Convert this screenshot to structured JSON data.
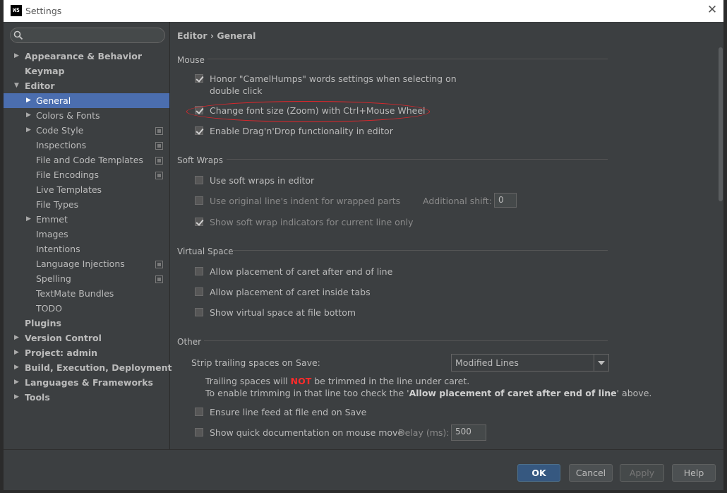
{
  "window": {
    "title": "Settings",
    "app_icon": "WS"
  },
  "search": {
    "placeholder": ""
  },
  "tree": [
    {
      "label": "Appearance & Behavior",
      "level": 0,
      "arrow": "▶"
    },
    {
      "label": "Keymap",
      "level": 0,
      "arrow": ""
    },
    {
      "label": "Editor",
      "level": 0,
      "arrow": "▼"
    },
    {
      "label": "General",
      "level": 1,
      "arrow": "▶",
      "selected": true
    },
    {
      "label": "Colors & Fonts",
      "level": 1,
      "arrow": "▶"
    },
    {
      "label": "Code Style",
      "level": 1,
      "arrow": "▶",
      "project": true
    },
    {
      "label": "Inspections",
      "level": 1,
      "arrow": "",
      "project": true
    },
    {
      "label": "File and Code Templates",
      "level": 1,
      "arrow": "",
      "project": true
    },
    {
      "label": "File Encodings",
      "level": 1,
      "arrow": "",
      "project": true
    },
    {
      "label": "Live Templates",
      "level": 1,
      "arrow": ""
    },
    {
      "label": "File Types",
      "level": 1,
      "arrow": ""
    },
    {
      "label": "Emmet",
      "level": 1,
      "arrow": "▶"
    },
    {
      "label": "Images",
      "level": 1,
      "arrow": ""
    },
    {
      "label": "Intentions",
      "level": 1,
      "arrow": ""
    },
    {
      "label": "Language Injections",
      "level": 1,
      "arrow": "",
      "project": true
    },
    {
      "label": "Spelling",
      "level": 1,
      "arrow": "",
      "project": true
    },
    {
      "label": "TextMate Bundles",
      "level": 1,
      "arrow": ""
    },
    {
      "label": "TODO",
      "level": 1,
      "arrow": ""
    },
    {
      "label": "Plugins",
      "level": 0,
      "arrow": ""
    },
    {
      "label": "Version Control",
      "level": 0,
      "arrow": "▶"
    },
    {
      "label": "Project: admin",
      "level": 0,
      "arrow": "▶"
    },
    {
      "label": "Build, Execution, Deployment",
      "level": 0,
      "arrow": "▶"
    },
    {
      "label": "Languages & Frameworks",
      "level": 0,
      "arrow": "▶"
    },
    {
      "label": "Tools",
      "level": 0,
      "arrow": "▶"
    }
  ],
  "breadcrumb": "Editor › General",
  "mouse": {
    "title": "Mouse",
    "camel_line1": "Honor \"CamelHumps\" words settings when selecting on",
    "camel_line2": "double click",
    "zoom": "Change font size (Zoom) with Ctrl+Mouse Wheel",
    "dnd": "Enable Drag'n'Drop functionality in editor"
  },
  "soft_wraps": {
    "title": "Soft Wraps",
    "use": "Use soft wraps in editor",
    "indent": "Use original line's indent for wrapped parts",
    "shift_label": "Additional shift:",
    "shift_value": "0",
    "indicators": "Show soft wrap indicators for current line only"
  },
  "virtual_space": {
    "title": "Virtual Space",
    "after_end": "Allow placement of caret after end of line",
    "inside_tabs": "Allow placement of caret inside tabs",
    "file_bottom": "Show virtual space at file bottom"
  },
  "other": {
    "title": "Other",
    "strip_label": "Strip trailing spaces on Save:",
    "strip_value": "Modified Lines",
    "note1_a": "Trailing spaces will ",
    "note1_warn": "NOT",
    "note1_b": " be trimmed in the line under caret.",
    "note2_a": "To enable trimming in that line too check the '",
    "note2_bold": "Allow placement of caret after end of line",
    "note2_b": "' above.",
    "line_feed": "Ensure line feed at file end on Save",
    "quick_doc": "Show quick documentation on mouse move",
    "delay_label": "Delay (ms):",
    "delay_value": "500"
  },
  "buttons": {
    "ok": "OK",
    "cancel": "Cancel",
    "apply": "Apply",
    "help": "Help"
  }
}
